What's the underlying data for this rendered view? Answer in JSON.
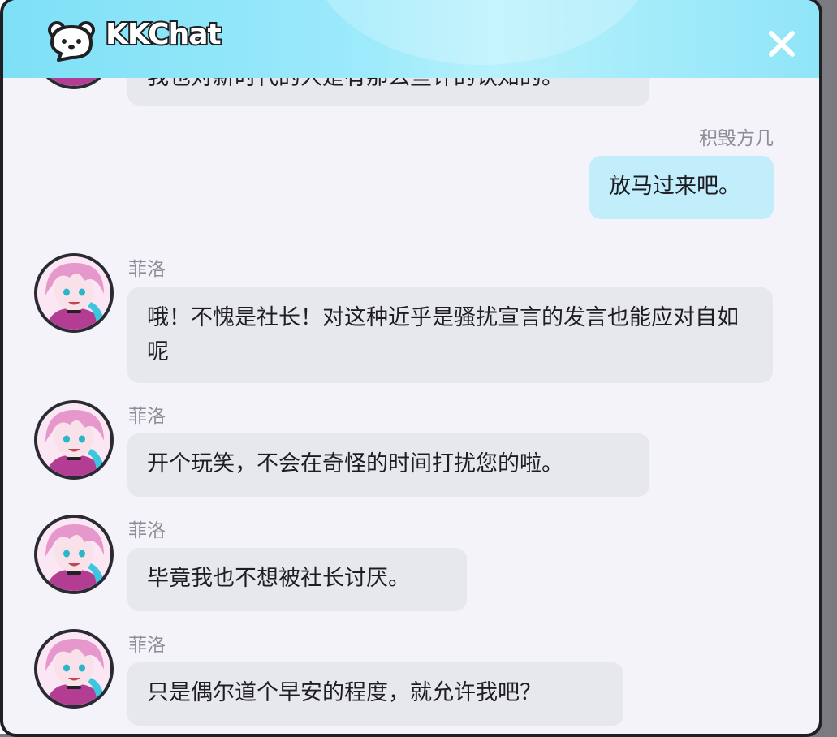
{
  "window": {
    "title": "KKChat",
    "logo_icon": "bear-logo-icon",
    "close_icon": "close-icon"
  },
  "messages": [
    {
      "side": "left",
      "sender": "",
      "text": "我也对新时代的人是有那么些许的认知的。"
    },
    {
      "side": "right",
      "sender": "积毁方几",
      "text": "放马过来吧。"
    },
    {
      "side": "left",
      "sender": "菲洛",
      "text": "哦！不愧是社长！对这种近乎是骚扰宣言的发言也能应对自如呢"
    },
    {
      "side": "left",
      "sender": "菲洛",
      "text": "开个玩笑，不会在奇怪的时间打扰您的啦。"
    },
    {
      "side": "left",
      "sender": "菲洛",
      "text": "毕竟我也不想被社长讨厌。"
    },
    {
      "side": "left",
      "sender": "菲洛",
      "text": "只是偶尔道个早安的程度，就允许我吧？"
    }
  ],
  "colors": {
    "header": "#8fe5f8",
    "incoming_bubble": "#e7e7ee",
    "outgoing_bubble": "#c2eefb",
    "background": "#f3f3f9"
  }
}
